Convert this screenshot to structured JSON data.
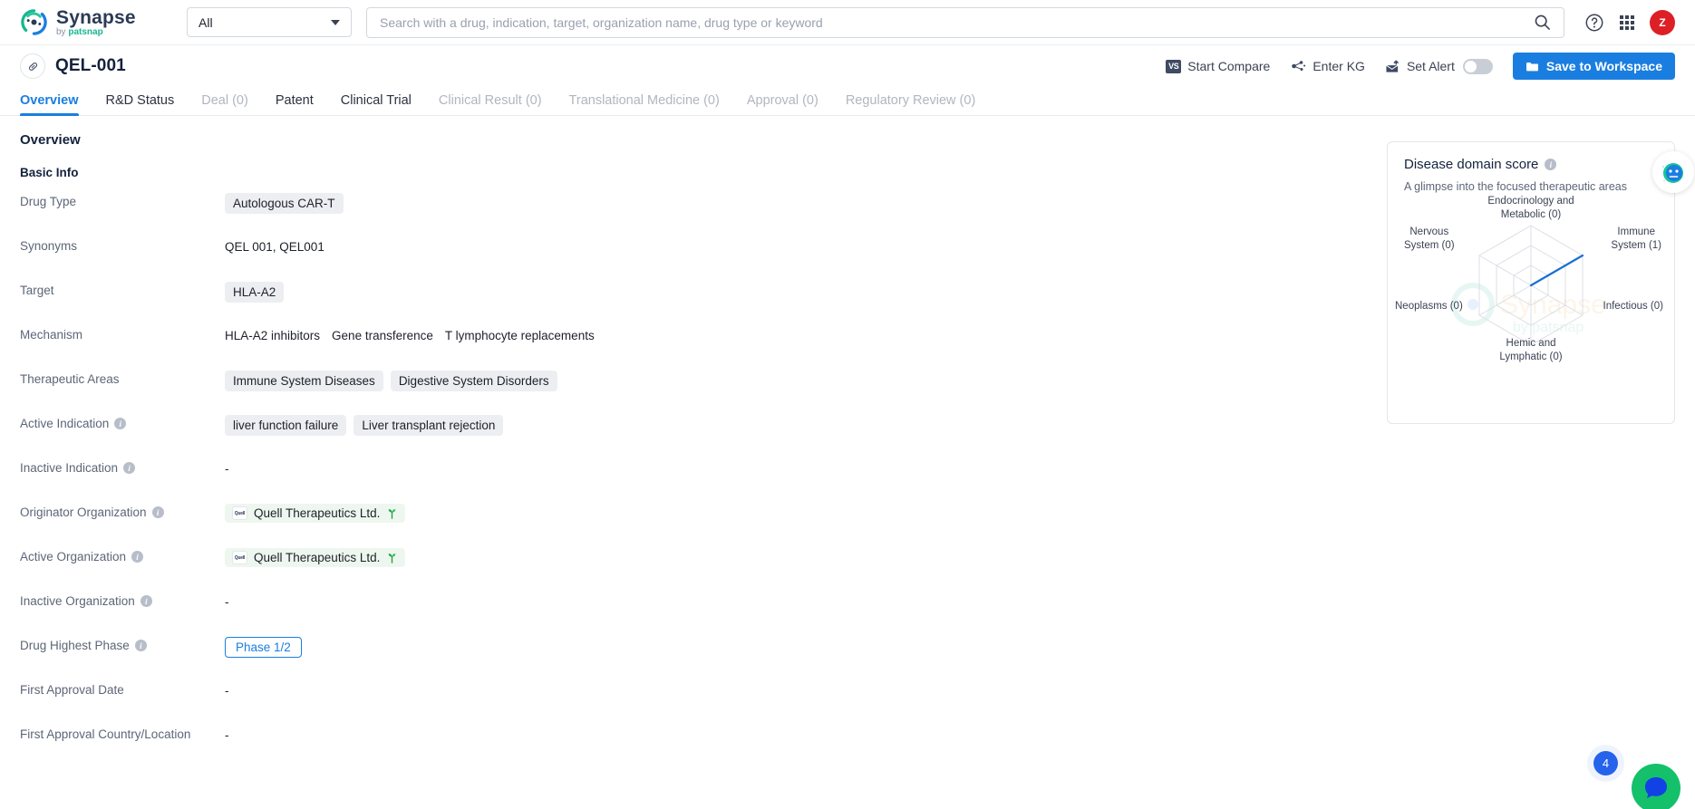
{
  "brand": {
    "name": "Synapse",
    "tagline_prefix": "by ",
    "tagline_brand": "patsnap",
    "logo_icon": "synapse-logo-icon"
  },
  "topbar": {
    "scope_selected": "All",
    "scope_caret_icon": "chevron-down-icon",
    "search_placeholder": "Search with a drug, indication, target, organization name, drug type or keyword",
    "search_value": "",
    "search_icon": "search-icon",
    "help_icon": "help-circle-icon",
    "apps_icon": "grid-apps-icon",
    "avatar_initial": "Z"
  },
  "entity": {
    "icon": "capsule-pill-icon",
    "title": "QEL-001",
    "actions": {
      "start_compare": {
        "label": "Start Compare",
        "icon": "vs-icon"
      },
      "enter_kg": {
        "label": "Enter KG",
        "icon": "knowledge-graph-icon"
      },
      "set_alert": {
        "label": "Set Alert",
        "icon": "alert-mail-icon",
        "toggle_state": "off"
      },
      "save_to_workspace": {
        "label": "Save to Workspace",
        "icon": "folder-icon"
      }
    }
  },
  "tabs": [
    {
      "label": "Overview",
      "state": "active"
    },
    {
      "label": "R&D Status",
      "state": "normal"
    },
    {
      "label": "Deal (0)",
      "state": "muted"
    },
    {
      "label": "Patent",
      "state": "normal"
    },
    {
      "label": "Clinical Trial",
      "state": "normal"
    },
    {
      "label": "Clinical Result (0)",
      "state": "muted"
    },
    {
      "label": "Translational Medicine (0)",
      "state": "muted"
    },
    {
      "label": "Approval (0)",
      "state": "muted"
    },
    {
      "label": "Regulatory Review (0)",
      "state": "muted"
    }
  ],
  "overview": {
    "heading": "Overview",
    "section_heading": "Basic Info",
    "fields": {
      "drug_type": {
        "label": "Drug Type",
        "values": [
          "Autologous CAR-T"
        ]
      },
      "synonyms": {
        "label": "Synonyms",
        "text": "QEL 001,  QEL001"
      },
      "target": {
        "label": "Target",
        "values": [
          "HLA-A2"
        ]
      },
      "mechanism": {
        "label": "Mechanism",
        "values": [
          "HLA-A2 inhibitors",
          "Gene transference",
          "T lymphocyte replacements"
        ]
      },
      "therapeutic_areas": {
        "label": "Therapeutic Areas",
        "values": [
          "Immune System Diseases",
          "Digestive System Disorders"
        ]
      },
      "active_indication": {
        "label": "Active Indication",
        "has_info": true,
        "values": [
          "liver function failure",
          "Liver transplant rejection"
        ]
      },
      "inactive_indication": {
        "label": "Inactive Indication",
        "has_info": true,
        "text": "-"
      },
      "originator_organization": {
        "label": "Originator Organization",
        "has_info": true,
        "org": "Quell Therapeutics Ltd.",
        "org_logo_text": "Quell",
        "org_badge_icon": "sprout-icon"
      },
      "active_organization": {
        "label": "Active Organization",
        "has_info": true,
        "org": "Quell Therapeutics Ltd.",
        "org_logo_text": "Quell",
        "org_badge_icon": "sprout-icon"
      },
      "inactive_organization": {
        "label": "Inactive Organization",
        "has_info": true,
        "text": "-"
      },
      "drug_highest_phase": {
        "label": "Drug Highest Phase",
        "has_info": true,
        "value": "Phase 1/2"
      },
      "first_approval_date": {
        "label": "First Approval Date",
        "text": "-"
      },
      "first_approval_country": {
        "label": "First Approval Country/Location",
        "text": "-"
      }
    }
  },
  "radar_panel": {
    "title": "Disease domain score",
    "info_icon": "info-icon",
    "subtitle": "A glimpse into the focused therapeutic areas",
    "assistant_icon": "ai-assistant-icon"
  },
  "chart_data": {
    "type": "radar",
    "title": "Disease domain score",
    "subtitle": "A glimpse into the focused therapeutic areas",
    "categories": [
      "Endocrinology and Metabolic (0)",
      "Immune System (1)",
      "Infectious (0)",
      "Hemic and Lymphatic (0)",
      "Neoplasms (0)",
      "Nervous System (0)"
    ],
    "labels_multiline": [
      [
        "Endocrinology and",
        "Metabolic (0)"
      ],
      [
        "Immune",
        "System (1)"
      ],
      [
        "Infectious (0)"
      ],
      [
        "Hemic and",
        "Lymphatic (0)"
      ],
      [
        "Neoplasms (0)"
      ],
      [
        "Nervous",
        "System (0)"
      ]
    ],
    "values": [
      0,
      1,
      0,
      0,
      0,
      0
    ],
    "rmax": 1,
    "rings": 3,
    "grid": true,
    "legend": "none",
    "series_color": "#1a6fd4",
    "grid_color": "#dcdfe4"
  },
  "fab": {
    "badge_count": "4",
    "icon": "chat-assistant-icon"
  },
  "colors": {
    "accent": "#1a7ee0",
    "brand_green": "#17b890",
    "avatar_red": "#dd1f26",
    "chip_bg": "#eceef2",
    "org_chip_bg": "#eef7ef",
    "muted_text": "#b0b6c0",
    "label_text": "#5c6677"
  }
}
